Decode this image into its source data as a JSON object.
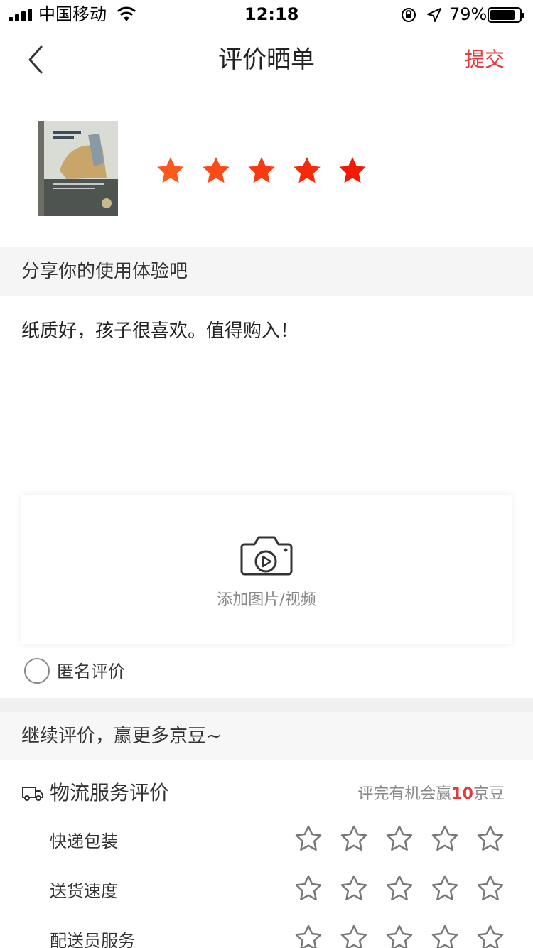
{
  "status_bar": {
    "carrier": "中国移动",
    "time": "12:18",
    "battery": "79%"
  },
  "nav": {
    "title": "评价晒单",
    "submit_label": "提交"
  },
  "product": {
    "rating": 5,
    "star_colors": [
      "#fb5a1f",
      "#fa4a18",
      "#f73a12",
      "#f52a0c",
      "#f21a06"
    ]
  },
  "share_section": {
    "label": "分享你的使用体验吧"
  },
  "review": {
    "text": "纸质好，孩子很喜欢。值得购入！"
  },
  "media": {
    "label": "添加图片/视频"
  },
  "anonymous": {
    "label": "匿名评价",
    "checked": false
  },
  "continue_section": {
    "label": "继续评价，赢更多京豆~"
  },
  "logistics": {
    "title": "物流服务评价",
    "hint_prefix": "评完有机会赢",
    "hint_number": "10",
    "hint_suffix": "京豆",
    "items": [
      {
        "label": "快递包装",
        "rating": 0
      },
      {
        "label": "送货速度",
        "rating": 0
      },
      {
        "label": "配送员服务",
        "rating": 0
      }
    ]
  },
  "colors": {
    "accent": "#e4393c",
    "section_bg": "#f5f5f5",
    "star_outline": "#777777"
  }
}
